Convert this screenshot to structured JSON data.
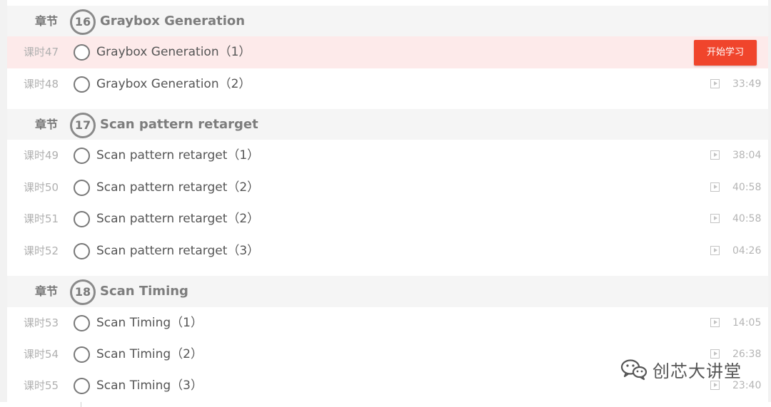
{
  "chapter_label": "章节",
  "colors": {
    "accent": "#f0452c",
    "active_row": "#fdeaea"
  },
  "chapters": [
    {
      "number": "16",
      "title": "Graybox Generation",
      "lessons": [
        {
          "label": "课时47",
          "title": "Graybox Generation（1）",
          "duration": "",
          "active": true,
          "action": "开始学习"
        },
        {
          "label": "课时48",
          "title": "Graybox Generation（2）",
          "duration": "33:49"
        }
      ]
    },
    {
      "number": "17",
      "title": "Scan pattern retarget",
      "lessons": [
        {
          "label": "课时49",
          "title": "Scan pattern retarget（1）",
          "duration": "38:04"
        },
        {
          "label": "课时50",
          "title": "Scan pattern retarget（2）",
          "duration": "40:58"
        },
        {
          "label": "课时51",
          "title": "Scan pattern retarget（2）",
          "duration": "40:58"
        },
        {
          "label": "课时52",
          "title": "Scan pattern retarget（3）",
          "duration": "04:26"
        }
      ]
    },
    {
      "number": "18",
      "title": "Scan Timing",
      "lessons": [
        {
          "label": "课时53",
          "title": "Scan Timing（1）",
          "duration": "14:05"
        },
        {
          "label": "课时54",
          "title": "Scan Timing（2）",
          "duration": "26:38"
        },
        {
          "label": "课时55",
          "title": "Scan Timing（3）",
          "duration": "23:40"
        }
      ]
    }
  ],
  "watermark": {
    "text": "创芯大讲堂",
    "icon": "wechat-icon"
  }
}
